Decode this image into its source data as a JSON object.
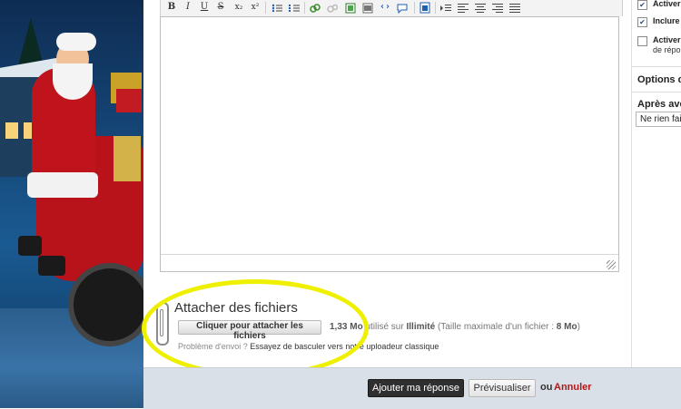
{
  "toolbar": {
    "buttons": [
      "B",
      "I",
      "U",
      "S",
      "x₂",
      "x²"
    ]
  },
  "attachments": {
    "title": "Attacher des fichiers",
    "button_label": "Cliquer pour attacher les fichiers",
    "used": "1,33 Mo",
    "used_suffix": " utilisé sur ",
    "limit": "Illimité",
    "max_prefix": " (Taille maximale d'un fichier : ",
    "max_size": "8 Mo",
    "max_suffix": ")",
    "help_prefix": "Problème d'envoi ? ",
    "help_link": "Essayez de basculer vers notre uploadeur classique"
  },
  "actions": {
    "submit_label": "Ajouter ma réponse",
    "preview_label": "Prévisualiser",
    "or_text": "ou",
    "cancel_label": "Annuler"
  },
  "sidebar": {
    "options": [
      {
        "label": "Activer",
        "checked": true,
        "sub": ""
      },
      {
        "label": "Inclure",
        "checked": true,
        "sub": ""
      },
      {
        "label": "Activer",
        "checked": false,
        "sub": "de répo"
      }
    ],
    "section_title": "Options d",
    "after_label": "Après avo",
    "after_value": "Ne rien fai"
  },
  "colors": {
    "highlight": "#eef000",
    "cancel": "#b01818",
    "action_bar": "#d9e0e8"
  }
}
